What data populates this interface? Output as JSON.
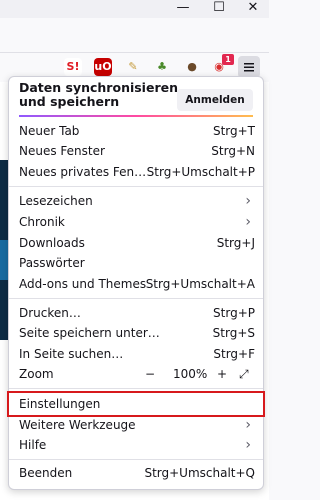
{
  "window": {
    "minimize": "—",
    "maximize": "☐",
    "close": "✕"
  },
  "menu": {
    "sync_title": "Daten synchronisieren und speichern",
    "signin_label": "Anmelden",
    "badge": "1",
    "items": [
      {
        "label": "Neuer Tab",
        "shortcut": "Strg+T"
      },
      {
        "label": "Neues Fenster",
        "shortcut": "Strg+N"
      },
      {
        "label": "Neues privates Fen…",
        "shortcut": "Strg+Umschalt+P"
      },
      {
        "label": "Lesezeichen",
        "shortcut": ""
      },
      {
        "label": "Chronik",
        "shortcut": ""
      },
      {
        "label": "Downloads",
        "shortcut": "Strg+J"
      },
      {
        "label": "Passwörter",
        "shortcut": ""
      },
      {
        "label": "Add-ons und Themes",
        "shortcut": "Strg+Umschalt+A"
      },
      {
        "label": "Drucken…",
        "shortcut": "Strg+P"
      },
      {
        "label": "Seite speichern unter…",
        "shortcut": "Strg+S"
      },
      {
        "label": "In Seite suchen…",
        "shortcut": "Strg+F"
      },
      {
        "label": "Zoom",
        "shortcut": ""
      },
      {
        "label": "Einstellungen",
        "shortcut": ""
      },
      {
        "label": "Weitere Werkzeuge",
        "shortcut": ""
      },
      {
        "label": "Hilfe",
        "shortcut": ""
      },
      {
        "label": "Beenden",
        "shortcut": "Strg+Umschalt+Q"
      }
    ],
    "zoom": {
      "minus": "−",
      "value": "100%",
      "plus": "+",
      "fullscreen": "⤢"
    }
  }
}
